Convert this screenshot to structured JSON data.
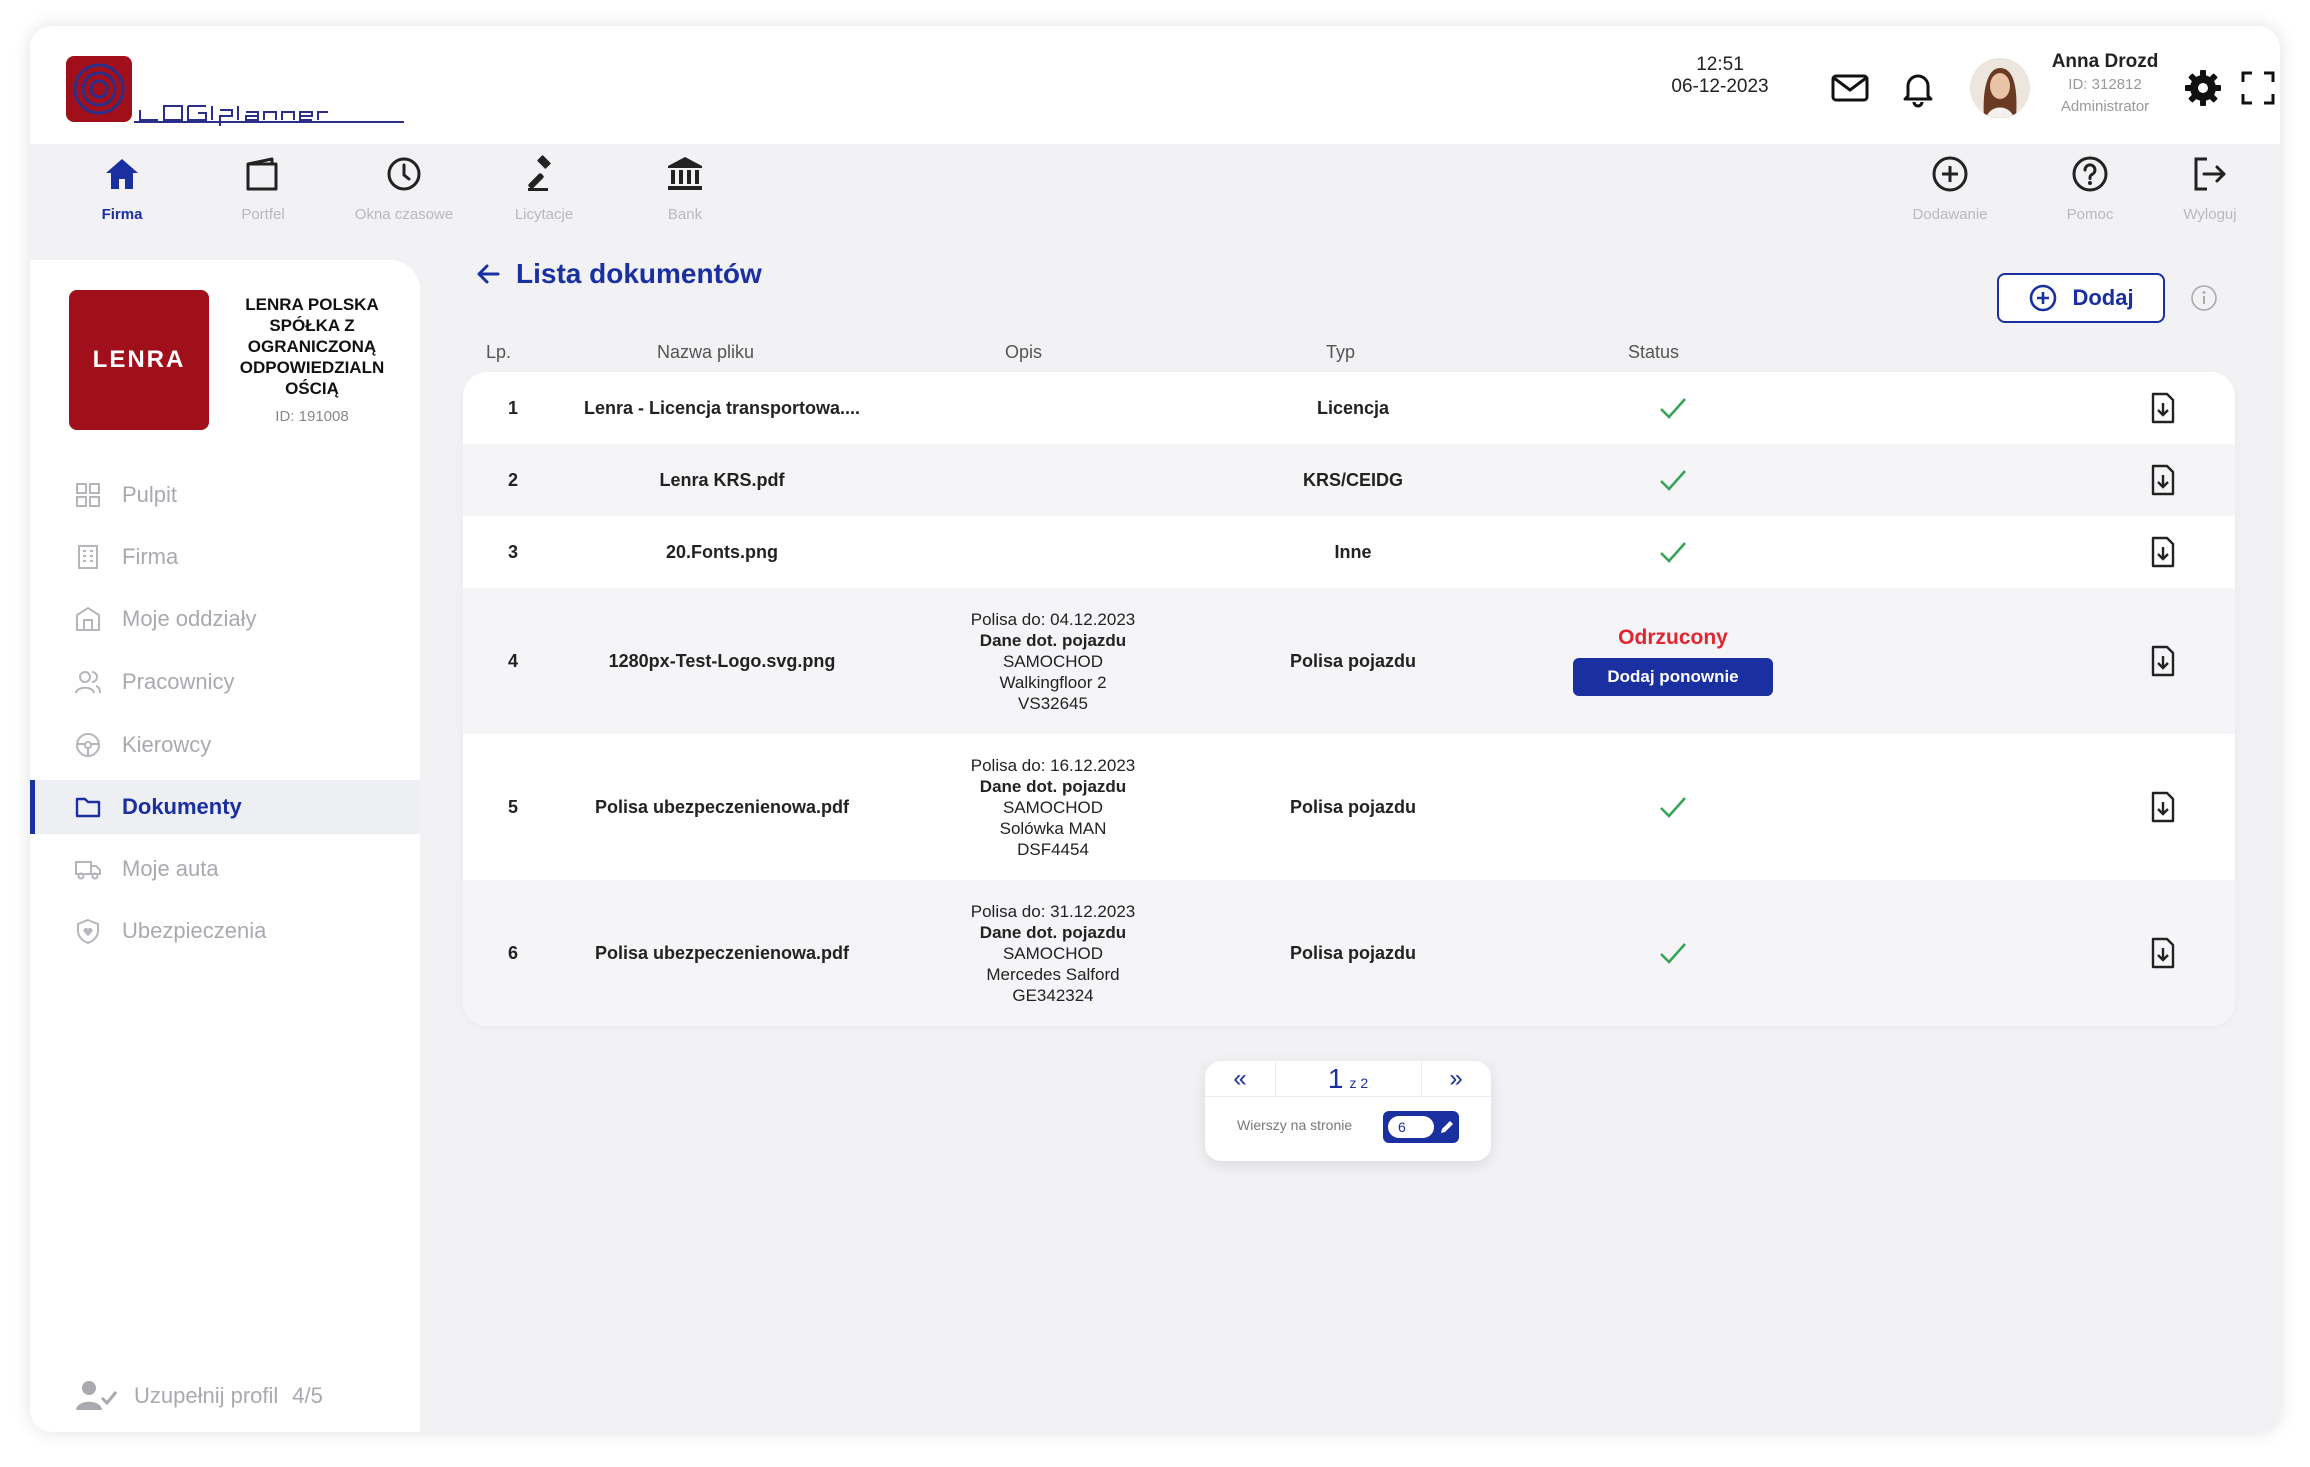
{
  "app": {
    "logo_text": "LOGIplanner"
  },
  "header": {
    "time": "12:51",
    "date": "06-12-2023",
    "user_name": "Anna Drozd",
    "user_id": "ID: 312812",
    "user_role": "Administrator"
  },
  "nav": {
    "left": [
      {
        "label": "Firma",
        "icon": "home-icon"
      },
      {
        "label": "Portfel",
        "icon": "wallet-icon"
      },
      {
        "label": "Okna czasowe",
        "icon": "clock-icon"
      },
      {
        "label": "Licytacje",
        "icon": "gavel-icon"
      },
      {
        "label": "Bank",
        "icon": "bank-icon"
      }
    ],
    "right": [
      {
        "label": "Dodawanie",
        "icon": "plus-circle-icon"
      },
      {
        "label": "Pomoc",
        "icon": "help-icon"
      },
      {
        "label": "Wyloguj",
        "icon": "logout-icon"
      }
    ]
  },
  "company": {
    "logo_text": "LENRA",
    "name": "LENRA POLSKA SPÓŁKA Z OGRANICZONĄ ODPOWIEDZIALN OŚCIĄ",
    "id": "ID: 191008"
  },
  "sidebar": {
    "items": [
      {
        "label": "Pulpit",
        "icon": "dashboard-icon"
      },
      {
        "label": "Firma",
        "icon": "building-icon"
      },
      {
        "label": "Moje oddziały",
        "icon": "branches-icon"
      },
      {
        "label": "Pracownicy",
        "icon": "users-icon"
      },
      {
        "label": "Kierowcy",
        "icon": "steering-wheel-icon"
      },
      {
        "label": "Dokumenty",
        "icon": "folder-icon"
      },
      {
        "label": "Moje auta",
        "icon": "truck-icon"
      },
      {
        "label": "Ubezpieczenia",
        "icon": "shield-heart-icon"
      }
    ],
    "active": "Dokumenty",
    "profile_label": "Uzupełnij profil",
    "profile_count": "4/5"
  },
  "page": {
    "title": "Lista dokumentów",
    "add_label": "Dodaj"
  },
  "table": {
    "headers": [
      "Lp.",
      "Nazwa pliku",
      "Opis",
      "Typ",
      "Status"
    ],
    "rows": [
      {
        "lp": "1",
        "name": "Lenra - Licencja transportowa....",
        "opis": [],
        "typ": "Licencja",
        "status": "ok"
      },
      {
        "lp": "2",
        "name": "Lenra KRS.pdf",
        "opis": [],
        "typ": "KRS/CEIDG",
        "status": "ok"
      },
      {
        "lp": "3",
        "name": "20.Fonts.png",
        "opis": [],
        "typ": "Inne",
        "status": "ok"
      },
      {
        "lp": "4",
        "name": "1280px-Test-Logo.svg.png",
        "opis": [
          "Polisa do: 04.12.2023",
          "Dane dot. pojazdu",
          "SAMOCHOD",
          "Walkingfloor 2",
          "VS32645"
        ],
        "typ": "Polisa pojazdu",
        "status": "rejected",
        "status_text": "Odrzucony",
        "retry_label": "Dodaj ponownie"
      },
      {
        "lp": "5",
        "name": "Polisa ubezpeczenienowa.pdf",
        "opis": [
          "Polisa do: 16.12.2023",
          "Dane dot. pojazdu",
          "SAMOCHOD",
          "Solówka MAN",
          "DSF4454"
        ],
        "typ": "Polisa pojazdu",
        "status": "ok"
      },
      {
        "lp": "6",
        "name": "Polisa ubezpeczenienowa.pdf",
        "opis": [
          "Polisa do: 31.12.2023",
          "Dane dot. pojazdu",
          "SAMOCHOD",
          "Mercedes Salford",
          "GE342324"
        ],
        "typ": "Polisa pojazdu",
        "status": "ok"
      }
    ]
  },
  "pager": {
    "prev": "«",
    "next": "»",
    "page": "1",
    "of": "z 2",
    "rows_label": "Wierszy na stronie",
    "rows_value": "6"
  },
  "colors": {
    "accent": "#1a2fa0",
    "brand_red": "#a00f1a",
    "ok_green": "#3aa35a",
    "rejected_red": "#e3232e"
  }
}
